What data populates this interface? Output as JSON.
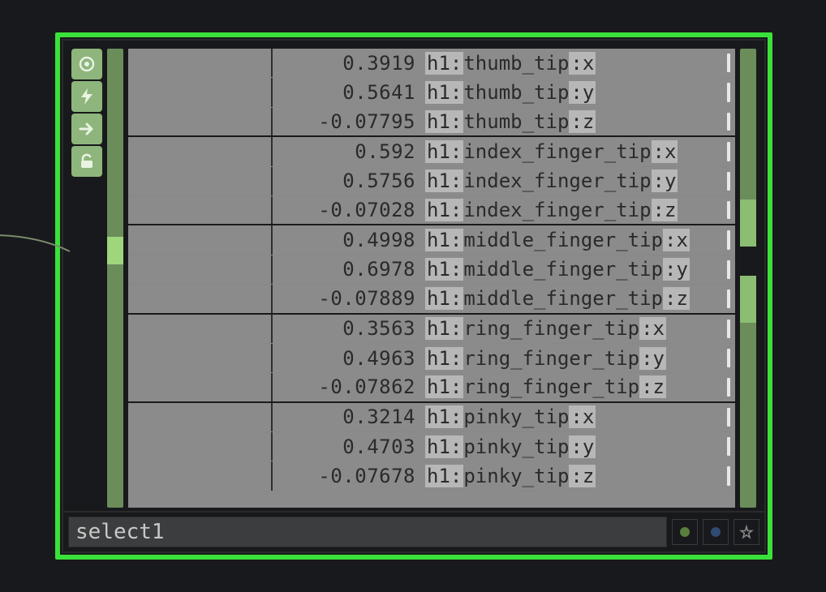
{
  "node": {
    "name": "select1"
  },
  "rows": [
    {
      "value": "0.3919",
      "name": "h1:thumb_tip:x",
      "group_end": false
    },
    {
      "value": "0.5641",
      "name": "h1:thumb_tip:y",
      "group_end": false
    },
    {
      "value": "-0.07795",
      "name": "h1:thumb_tip:z",
      "group_end": true
    },
    {
      "value": "0.592",
      "name": "h1:index_finger_tip:x",
      "group_end": false
    },
    {
      "value": "0.5756",
      "name": "h1:index_finger_tip:y",
      "group_end": false
    },
    {
      "value": "-0.07028",
      "name": "h1:index_finger_tip:z",
      "group_end": true
    },
    {
      "value": "0.4998",
      "name": "h1:middle_finger_tip:x",
      "group_end": false
    },
    {
      "value": "0.6978",
      "name": "h1:middle_finger_tip:y",
      "group_end": false
    },
    {
      "value": "-0.07889",
      "name": "h1:middle_finger_tip:z",
      "group_end": true
    },
    {
      "value": "0.3563",
      "name": "h1:ring_finger_tip:x",
      "group_end": false
    },
    {
      "value": "0.4963",
      "name": "h1:ring_finger_tip:y",
      "group_end": false
    },
    {
      "value": "-0.07862",
      "name": "h1:ring_finger_tip:z",
      "group_end": true
    },
    {
      "value": "0.3214",
      "name": "h1:pinky_tip:x",
      "group_end": false
    },
    {
      "value": "0.4703",
      "name": "h1:pinky_tip:y",
      "group_end": false
    },
    {
      "value": "-0.07678",
      "name": "h1:pinky_tip:z",
      "group_end": false
    }
  ],
  "icons": {
    "viewer": "target-icon",
    "activate": "lightning-icon",
    "jump": "arrow-right-icon",
    "lock": "unlock-icon"
  },
  "flags": {
    "cook": "green",
    "bypass": "blue",
    "display": "star"
  }
}
